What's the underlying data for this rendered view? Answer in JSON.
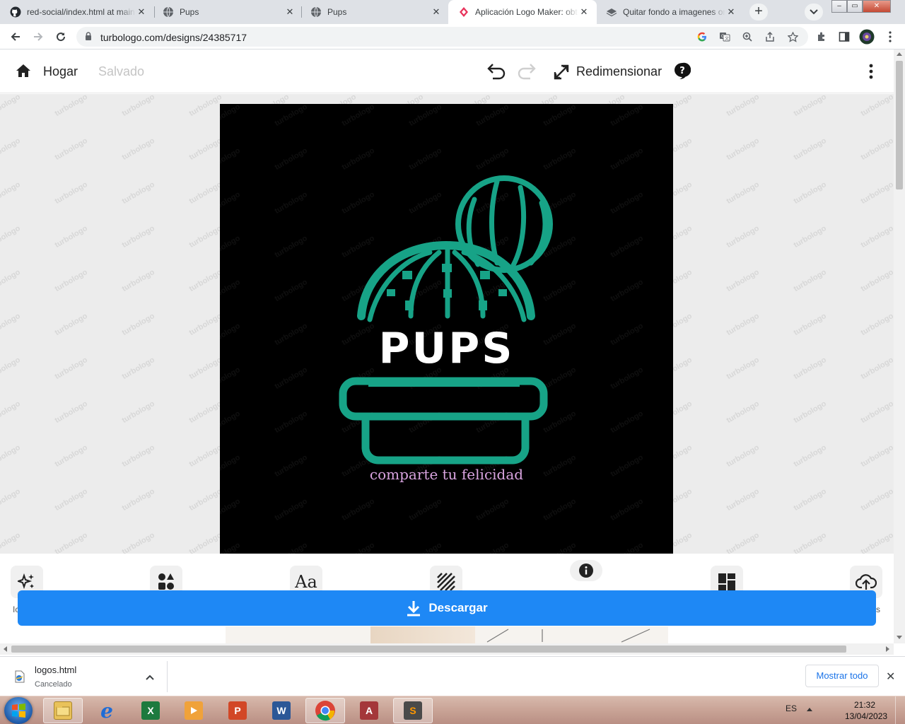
{
  "browser": {
    "tabs": [
      {
        "title": "red-social/index.html at main",
        "icon": "github-icon"
      },
      {
        "title": "Pups",
        "icon": "globe-icon"
      },
      {
        "title": "Pups",
        "icon": "globe-icon"
      },
      {
        "title": "Aplicación Logo Maker: obtén",
        "icon": "turbologo-icon",
        "active": true
      },
      {
        "title": "Quitar fondo a imagenes online",
        "icon": "layers-icon"
      }
    ],
    "url": "turbologo.com/designs/24385717"
  },
  "app": {
    "home_label": "Hogar",
    "saved_label": "Salvado",
    "resize_label": "Redimensionar",
    "watermark": "turbologo"
  },
  "logo": {
    "brand_name": "PUPS",
    "slogan": "comparte tu felicidad",
    "colors": {
      "background": "#000000",
      "cactus": "#17a387",
      "brand_text": "#ffffff",
      "slogan": "#d9a4e0"
    }
  },
  "tools": {
    "download_label": "Descargar",
    "left_fragment": "Ic",
    "right_fragment": "s"
  },
  "downloads": {
    "file_name": "logos.html",
    "file_status": "Cancelado",
    "show_all": "Mostrar todo"
  },
  "taskbar": {
    "language": "ES",
    "time": "21:32",
    "date": "13/04/2023",
    "apps": [
      "explorer-icon",
      "internet-explorer-icon",
      "excel-icon",
      "media-player-icon",
      "powerpoint-icon",
      "word-icon",
      "chrome-icon",
      "access-icon",
      "sublime-text-icon"
    ]
  }
}
